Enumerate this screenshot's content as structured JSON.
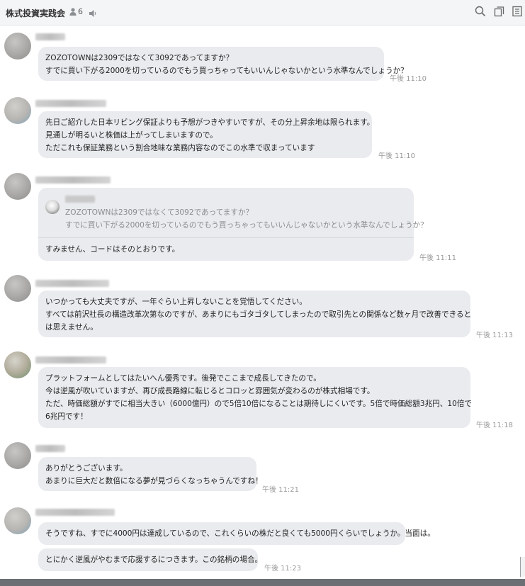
{
  "header": {
    "title": "株式投資実践会",
    "member_count": "6"
  },
  "messages": [
    {
      "lines": [
        "ZOZOTOWNは2309ではなくて3092であってますか？",
        "すでに買い下がる2000を切っているのでもう買っちゃってもいいんじゃないかという水準なんでしょうか？"
      ],
      "time": "午後 11:10"
    },
    {
      "lines": [
        "先日ご紹介した日本リビング保証よりも予想がつきやすいですが、その分上昇余地は限られます。",
        "見通しが明るいと株価は上がってしまいますので。",
        "ただこれも保証業務という割合地味な業務内容なのでこの水準で収まっています"
      ],
      "time": "午後 11:10"
    },
    {
      "quote_lines": [
        "ZOZOTOWNは2309ではなくて3092であってますか？",
        "すでに買い下がる2000を切っているのでもう買っちゃってもいいんじゃないかという水準なんでしょうか？"
      ],
      "reply": "すみません、コードはそのとおりです。",
      "time": "午後 11:11"
    },
    {
      "lines": [
        "いつかっても大丈夫ですが、一年ぐらい上昇しないことを覚悟してください。",
        "すべては前沢社長の構造改革次第なのですが、あまりにもゴタゴタしてしまったので取引先との関係など数ヶ月で改善できると",
        "は思えません。"
      ],
      "time": "午後 11:13"
    },
    {
      "lines": [
        "プラットフォームとしてはたいへん優秀です。後発でここまで成長してきたので。",
        "今は逆風が吹いていますが、再び成長路線に転じるとコロッと雰囲気が変わるのが株式相場です。",
        "ただ、時価総額がすでに相当大きい（6000億円）ので5倍10倍になることは期待しにくいです。5倍で時価総額3兆円、10倍で",
        "6兆円です！"
      ],
      "time": "午後 11:18"
    },
    {
      "lines": [
        "ありがとうございます。",
        "あまりに巨大だと数倍になる夢が見づらくなっちゃうんですね！"
      ],
      "time": "午後 11:21"
    },
    {
      "lines": [
        "そうですね、すでに4000円は達成しているので、これくらいの株だと良くても5000円くらいでしょうか。当面は。"
      ],
      "lines2": [
        "とにかく逆風がやむまで応援するにつきます。この銘柄の場合。"
      ],
      "time": "午後 11:23"
    }
  ],
  "icons": {
    "member": "person-icon",
    "speaker": "speaker-icon",
    "search": "search-icon",
    "copy": "copy-icon",
    "menu": "notes-icon"
  }
}
